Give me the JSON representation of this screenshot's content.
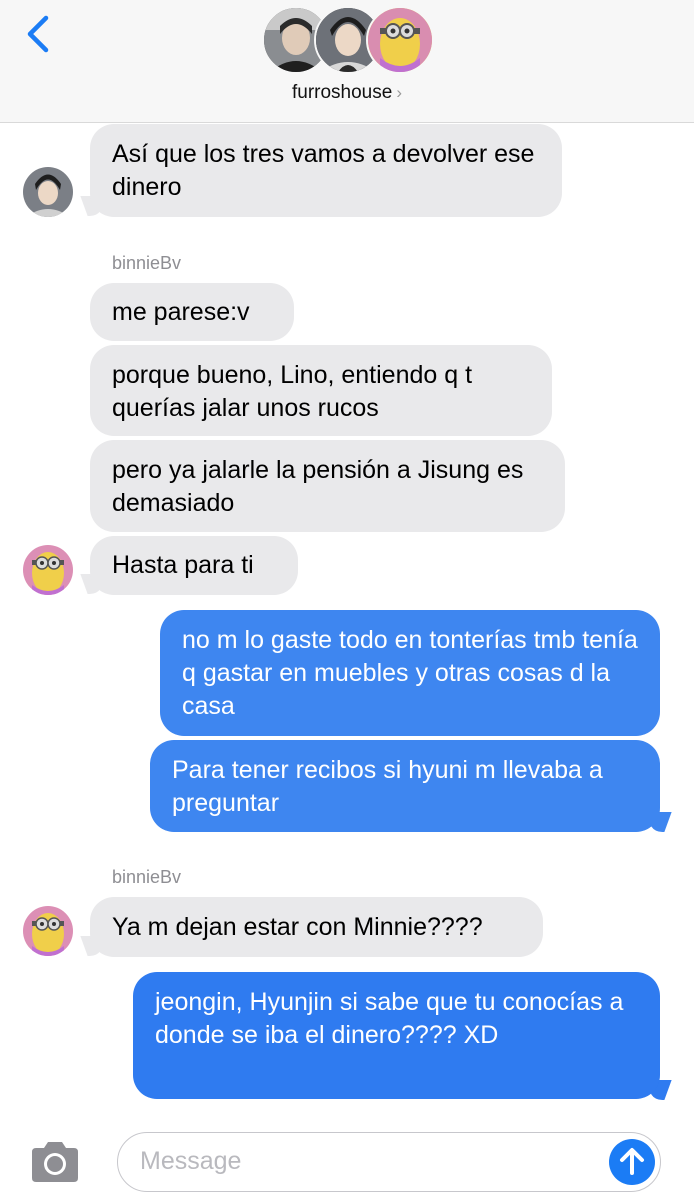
{
  "header": {
    "group_name": "furroshouse",
    "chevron": "›"
  },
  "messages": [
    {
      "text": "Así que los tres vamos a devolver ese dinero"
    },
    {
      "text": "me parese:v"
    },
    {
      "text": "porque bueno, Lino, entiendo q t querías jalar unos rucos"
    },
    {
      "text": "pero ya jalarle la pensión a Jisung es demasiado"
    },
    {
      "text": "Hasta para ti"
    },
    {
      "text": "no m lo gaste todo en tonterías tmb tenía q gastar en muebles y otras cosas d la casa"
    },
    {
      "text": "Para tener recibos si hyuni m llevaba a preguntar"
    },
    {
      "text": "Ya m dejan estar con Minnie????"
    },
    {
      "text": "jeongin, Hyunjin si sabe que tu conocías a donde se iba el dinero???? XD"
    }
  ],
  "senders": [
    "binnieBv",
    "binnieBv"
  ],
  "composer": {
    "placeholder": "Message"
  },
  "colors": {
    "incoming_bubble": "#e9e9eb",
    "outgoing_bubble": "#3e86f0",
    "accent": "#1b7cf5"
  },
  "icons": [
    "back-chevron-icon",
    "camera-icon",
    "send-arrow-icon"
  ]
}
